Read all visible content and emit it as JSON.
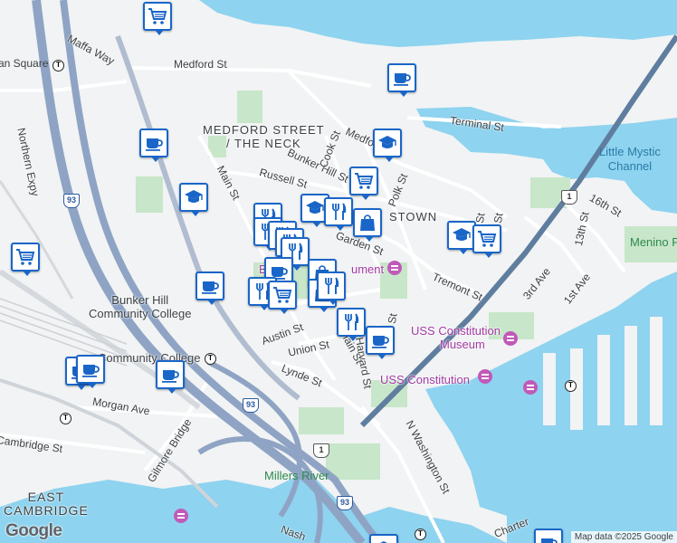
{
  "map": {
    "labels": {
      "streets": [
        {
          "id": "maffa-way",
          "text": "Maffa Way"
        },
        {
          "id": "medford-st-w",
          "text": "Medford St"
        },
        {
          "id": "northern-expy",
          "text": "Northern Expy"
        },
        {
          "id": "terminal-st",
          "text": "Terminal St"
        },
        {
          "id": "medford-st-e",
          "text": "Medford St"
        },
        {
          "id": "bunker-hill-st",
          "text": "Bunker Hill St"
        },
        {
          "id": "cook-st",
          "text": "Cook St"
        },
        {
          "id": "polk-st",
          "text": "Polk St"
        },
        {
          "id": "russell-st",
          "text": "Russell St"
        },
        {
          "id": "main-st",
          "text": "Main St"
        },
        {
          "id": "tremont-st",
          "text": "Tremont St"
        },
        {
          "id": "3rd-ave",
          "text": "3rd Ave"
        },
        {
          "id": "1st-ave",
          "text": "1st Ave"
        },
        {
          "id": "16th-st",
          "text": "16th St"
        },
        {
          "id": "13th-st",
          "text": "13th St"
        },
        {
          "id": "austin-st",
          "text": "Austin St"
        },
        {
          "id": "union-st",
          "text": "Union St"
        },
        {
          "id": "main-st-s",
          "text": "Main St"
        },
        {
          "id": "harvard-st",
          "text": "Harvard St"
        },
        {
          "id": "lynde-st",
          "text": "Lynde St"
        },
        {
          "id": "morgan-ave",
          "text": "Morgan Ave"
        },
        {
          "id": "cambridge-st",
          "text": "Cambridge St"
        },
        {
          "id": "gilmore-bridge",
          "text": "Gilmore Bridge"
        },
        {
          "id": "n-washington-st",
          "text": "N Washington St"
        },
        {
          "id": "garden-st",
          "text": "Garden St"
        },
        {
          "id": "charter-st",
          "text": "Charter"
        },
        {
          "id": "nash-st",
          "text": "Nash"
        },
        {
          "id": "st-a",
          "text": "St"
        },
        {
          "id": "st-b",
          "text": "St"
        },
        {
          "id": "st-c",
          "text": "St"
        }
      ],
      "neighborhoods": [
        {
          "id": "medford-street-neck",
          "line1": "MEDFORD STREET",
          "line2": "/ THE NECK"
        },
        {
          "id": "charlestown",
          "line1": "STOWN",
          "line2": ""
        },
        {
          "id": "east-cambridge",
          "line1": "EAST",
          "line2": "CAMBRIDGE"
        }
      ],
      "water": [
        {
          "id": "little-mystic",
          "line1": "Little Mystic",
          "line2": "Channel"
        },
        {
          "id": "millers-river",
          "line1": "Millers River",
          "line2": ""
        }
      ],
      "pois": [
        {
          "id": "bunker-hill-college",
          "line1": "Bunker Hill",
          "line2": "Community College"
        },
        {
          "id": "community-college-station",
          "line1": "Community College",
          "line2": ""
        },
        {
          "id": "bunker-hill-monument",
          "line1": "B",
          "line2": "ument"
        },
        {
          "id": "uss-museum",
          "line1": "USS Constitution",
          "line2": "Museum"
        },
        {
          "id": "uss-constitution",
          "line1": "USS Constitution",
          "line2": ""
        },
        {
          "id": "menino",
          "line1": "Menino P",
          "line2": ""
        },
        {
          "id": "union-square",
          "line1": "an Square",
          "line2": ""
        }
      ],
      "shields": [
        {
          "id": "i93-north",
          "text": "93",
          "kind": "i93"
        },
        {
          "id": "i93-central",
          "text": "93",
          "kind": "i93"
        },
        {
          "id": "i93-south",
          "text": "93",
          "kind": "i93"
        },
        {
          "id": "us1-north",
          "text": "1",
          "kind": "us1"
        },
        {
          "id": "us1-south",
          "text": "1",
          "kind": "us1"
        }
      ],
      "transit": {
        "symbol": "T"
      }
    },
    "markers": {
      "types": {
        "cart": "shopping-cart-icon",
        "coffee": "coffee-cup-icon",
        "school": "graduation-cap-icon",
        "food": "fork-knife-icon",
        "bag": "shopping-bag-icon"
      },
      "list": [
        {
          "type": "cart"
        },
        {
          "type": "coffee"
        },
        {
          "type": "coffee"
        },
        {
          "type": "school"
        },
        {
          "type": "school"
        },
        {
          "type": "cart"
        },
        {
          "type": "school"
        },
        {
          "type": "food"
        },
        {
          "type": "bag"
        },
        {
          "type": "school"
        },
        {
          "type": "cart"
        },
        {
          "type": "cart"
        },
        {
          "type": "food"
        },
        {
          "type": "food"
        },
        {
          "type": "food"
        },
        {
          "type": "food"
        },
        {
          "type": "food"
        },
        {
          "type": "coffee"
        },
        {
          "type": "bag"
        },
        {
          "type": "food"
        },
        {
          "type": "cart"
        },
        {
          "type": "bag"
        },
        {
          "type": "coffee"
        },
        {
          "type": "food"
        },
        {
          "type": "food"
        },
        {
          "type": "coffee"
        },
        {
          "type": "coffee"
        },
        {
          "type": "coffee"
        },
        {
          "type": "coffee"
        },
        {
          "type": "school"
        },
        {
          "type": "coffee"
        }
      ]
    },
    "colors": {
      "water": "#8ed3ef",
      "land": "#f1f3f4",
      "park": "#c8e6c9",
      "highway": "#8fa4c4",
      "marker_border": "#1a66c8"
    },
    "attribution": "Map data ©2025 Google",
    "logo": "Google"
  }
}
